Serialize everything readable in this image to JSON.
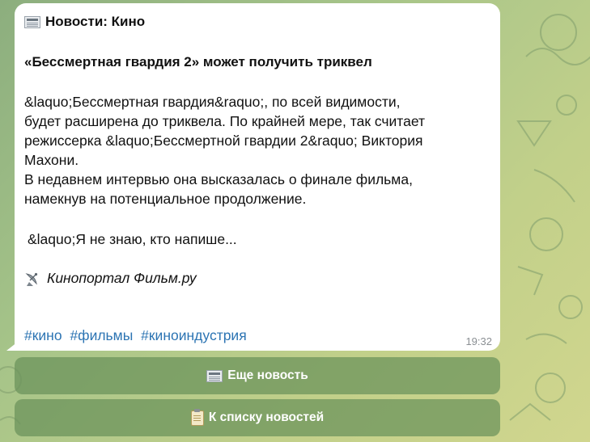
{
  "message": {
    "header": "Новости: Кино",
    "title": "«Бессмертная гвардия 2» может получить триквел",
    "body_lines": [
      "&laquo;Бессмертная гвардия&raquo;, по всей видимости,",
      "будет расширена до триквела. По крайней мере, так считает",
      "режиссерка &laquo;Бессмертной гвардии 2&raquo; Виктория",
      "Махони.",
      "В недавнем интервью она высказалась о финале фильма,",
      "намекнув на потенциальное продолжение."
    ],
    "quote": "&laquo;Я не знаю, кто напише...",
    "source": "Кинопортал Фильм.ру",
    "hashtags": [
      "#кино",
      "#фильмы",
      "#киноиндустрия"
    ],
    "time": "19:32"
  },
  "keyboard": {
    "more_news": "Еще новость",
    "back_to_list": "К списку новостей"
  },
  "icons": {
    "header": "newspaper-icon",
    "source": "satellite-dish-icon",
    "more_news": "newspaper-icon",
    "back_to_list": "clipboard-icon"
  },
  "colors": {
    "bubble": "#ffffff",
    "hashtag": "#2c74b3",
    "keyboard_button": "#69915a",
    "time": "#8a8f93"
  }
}
